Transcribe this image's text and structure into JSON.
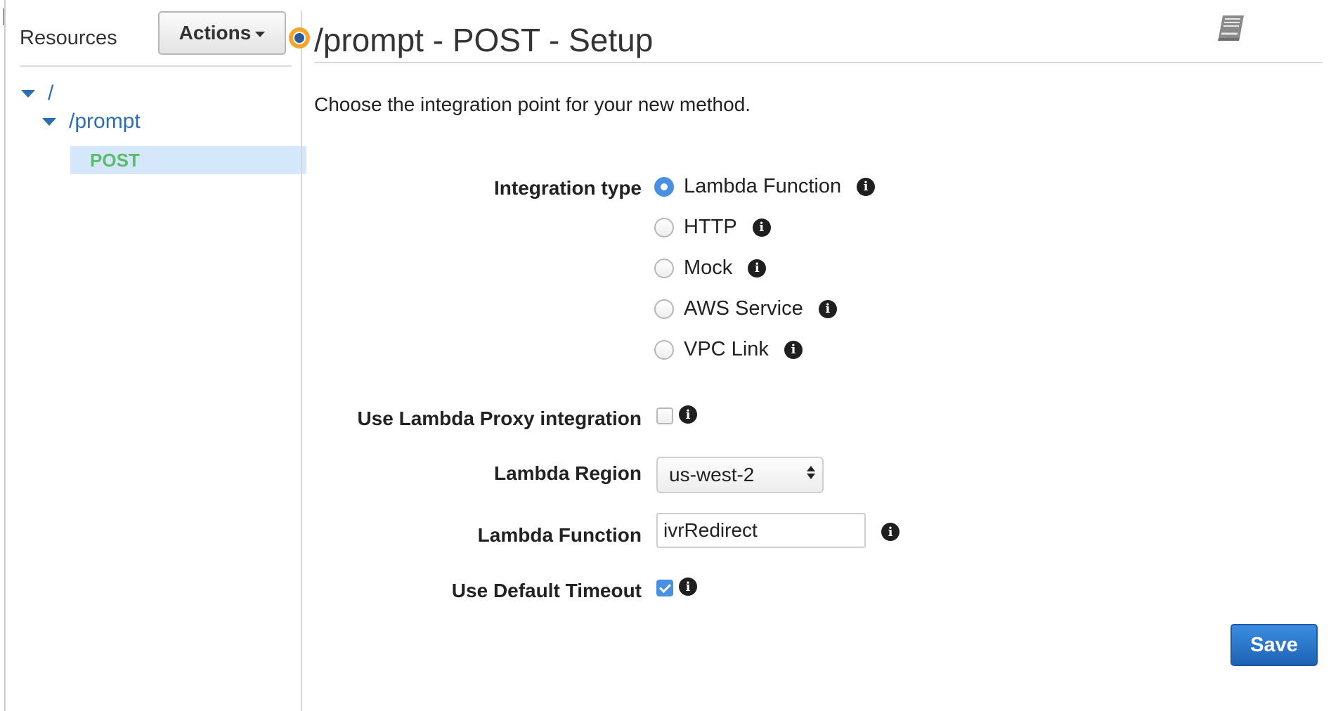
{
  "sidebar": {
    "title": "Resources",
    "actions_label": "Actions",
    "tree": {
      "root": "/",
      "child": "/prompt",
      "method": "POST"
    }
  },
  "main": {
    "title": "/prompt - POST - Setup",
    "intro": "Choose the integration point for your new method.",
    "integration_type": {
      "label": "Integration type",
      "options": [
        "Lambda Function",
        "HTTP",
        "Mock",
        "AWS Service",
        "VPC Link"
      ],
      "selected": "Lambda Function"
    },
    "proxy": {
      "label": "Use Lambda Proxy integration",
      "checked": false
    },
    "region": {
      "label": "Lambda Region",
      "value": "us-west-2"
    },
    "function": {
      "label": "Lambda Function",
      "value": "ivrRedirect"
    },
    "timeout": {
      "label": "Use Default Timeout",
      "checked": true
    },
    "save_label": "Save"
  },
  "icons": {
    "info": "info-icon",
    "book": "book-icon",
    "active_indicator": "active-indicator-icon"
  },
  "colors": {
    "accent": "#4a90e2",
    "link": "#2c6fb1",
    "method_green": "#5cbb6c",
    "selection_bg": "#d5e8fb",
    "save_blue": "#1e62b5",
    "indicator_orange": "#f4a52c"
  }
}
